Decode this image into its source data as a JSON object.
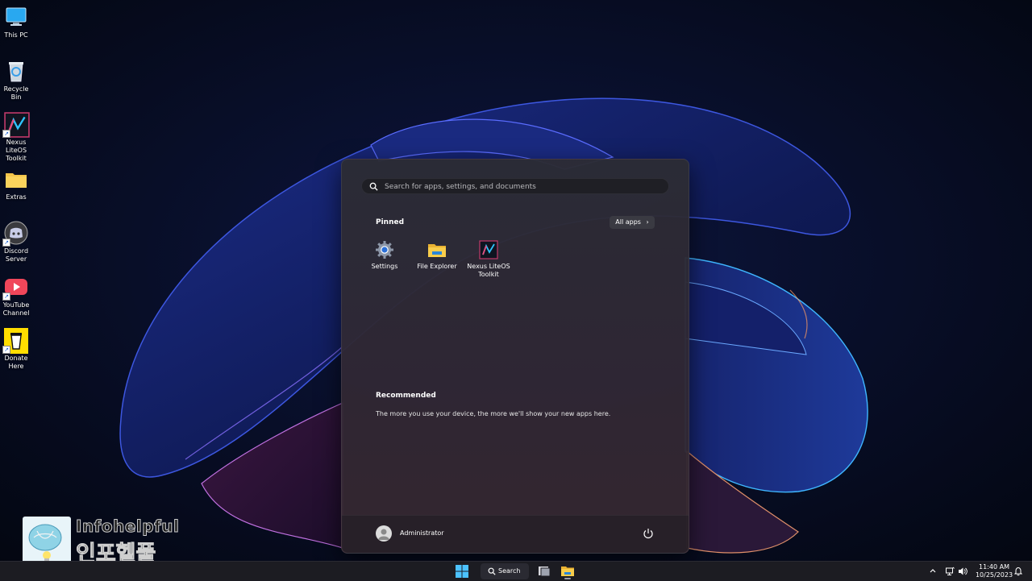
{
  "desktop": {
    "icons": [
      {
        "label": "This PC",
        "icon": "monitor-icon"
      },
      {
        "label": "Recycle Bin",
        "icon": "recycle-bin-icon"
      },
      {
        "label": "Nexus LiteOS Toolkit",
        "icon": "nexus-toolkit-icon"
      },
      {
        "label": "Extras",
        "icon": "folder-icon"
      },
      {
        "label": "Discord Server",
        "icon": "discord-icon"
      },
      {
        "label": "YouTube Channel",
        "icon": "youtube-icon"
      },
      {
        "label": "Donate Here",
        "icon": "coffee-cup-icon"
      }
    ]
  },
  "start_menu": {
    "search_placeholder": "Search for apps, settings, and documents",
    "pinned_title": "Pinned",
    "all_apps_label": "All apps",
    "pinned": [
      {
        "label": "Settings",
        "icon": "gear-icon"
      },
      {
        "label": "File Explorer",
        "icon": "folder-icon"
      },
      {
        "label": "Nexus LiteOS Toolkit",
        "icon": "nexus-toolkit-icon"
      }
    ],
    "recommended_title": "Recommended",
    "recommended_text": "The more you use your device, the more we'll show your new apps here.",
    "user_name": "Administrator"
  },
  "watermark": {
    "text_en": "Infohelpful",
    "text_ko": "인포헬풀"
  },
  "taskbar": {
    "search_label": "Search",
    "clock_time": "11:40 AM",
    "clock_date": "10/25/2023"
  },
  "colors": {
    "accent": "#4cc2ff",
    "folder": "#f5c542"
  }
}
